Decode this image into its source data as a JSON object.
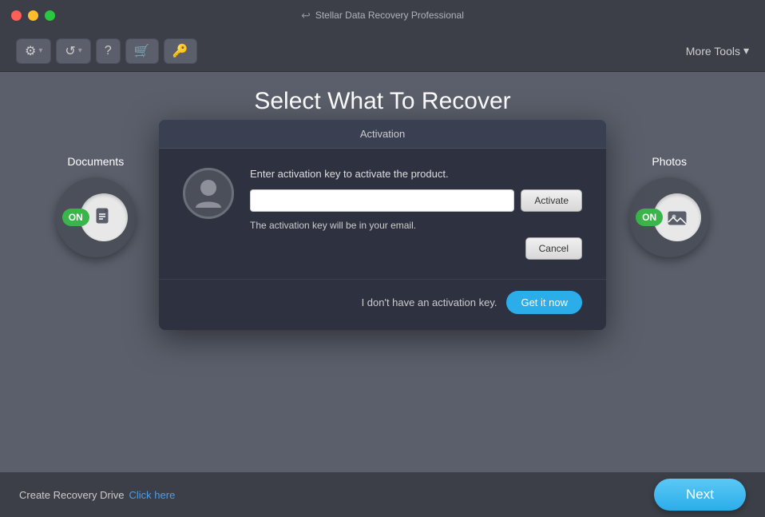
{
  "titlebar": {
    "title": "Stellar Data Recovery Professional",
    "back_icon": "↩"
  },
  "toolbar": {
    "settings_label": "⚙",
    "restore_label": "↺",
    "help_label": "?",
    "cart_label": "🛒",
    "key_label": "🔑",
    "more_tools_label": "More Tools",
    "dropdown_arrow": "▾"
  },
  "page": {
    "title": "Select What To Recover"
  },
  "activation_dialog": {
    "header": "Activation",
    "description": "Enter activation key to activate the product.",
    "input_placeholder": "",
    "activate_label": "Activate",
    "cancel_label": "Cancel",
    "note": "The activation key will be in your email.",
    "no_key_text": "I don't have an activation key.",
    "get_it_now_label": "Get it now"
  },
  "file_types": [
    {
      "id": "documents",
      "label": "Documents",
      "icon": "document",
      "on": true
    },
    {
      "id": "email",
      "label": "",
      "icon": "email",
      "on": true
    },
    {
      "id": "video",
      "label": "",
      "icon": "video",
      "on": true
    },
    {
      "id": "audio",
      "label": "",
      "icon": "audio",
      "on": true
    },
    {
      "id": "photos",
      "label": "Photos",
      "icon": "photo",
      "on": true
    }
  ],
  "bottom": {
    "recovery_drive_text": "Create Recovery Drive",
    "click_here_label": "Click here",
    "next_label": "Next"
  }
}
